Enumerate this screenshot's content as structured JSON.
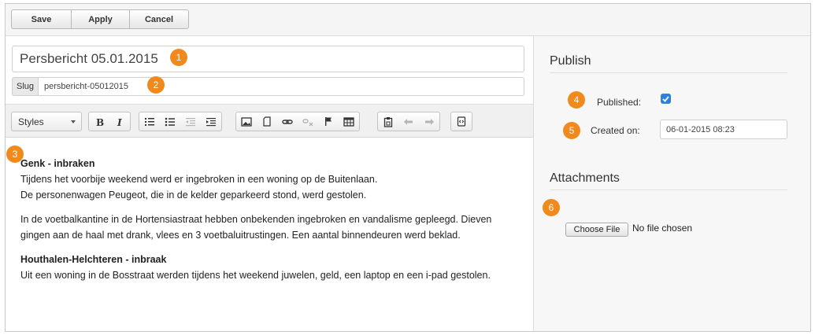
{
  "toolbar": {
    "save_label": "Save",
    "apply_label": "Apply",
    "cancel_label": "Cancel"
  },
  "editor": {
    "title_value": "Persbericht 05.01.2015",
    "slug_label": "Slug",
    "slug_value": "persbericht-05012015",
    "styles_label": "Styles",
    "paragraphs": [
      {
        "heading": "Genk - inbraken",
        "lines": [
          "Tijdens het voorbije weekend werd er ingebroken in een woning op de Buitenlaan.",
          "De personenwagen Peugeot, die in de kelder geparkeerd stond, werd gestolen."
        ]
      },
      {
        "heading": "",
        "lines": [
          "In de voetbalkantine in de Hortensiastraat hebben onbekenden ingebroken en vandalisme gepleegd. Dieven",
          "gingen aan de haal met drank, vlees en 3 voetbaluitrustingen. Een aantal binnendeuren werd beklad."
        ]
      },
      {
        "heading": "Houthalen-Helchteren - inbraak",
        "lines": [
          "Uit een woning in de Bosstraat werden tijdens het weekend juwelen, geld, een laptop en een i-pad gestolen."
        ]
      }
    ]
  },
  "publish": {
    "title": "Publish",
    "published_label": "Published:",
    "published_checked": true,
    "created_label": "Created on:",
    "created_value": "06-01-2015 08:23"
  },
  "attachments": {
    "title": "Attachments",
    "choose_file_label": "Choose File",
    "no_file_text": "No file chosen"
  },
  "callouts": [
    "1",
    "2",
    "3",
    "4",
    "5",
    "6"
  ],
  "colors": {
    "callout": "#f08a1c",
    "checkbox": "#2f7fe0"
  }
}
